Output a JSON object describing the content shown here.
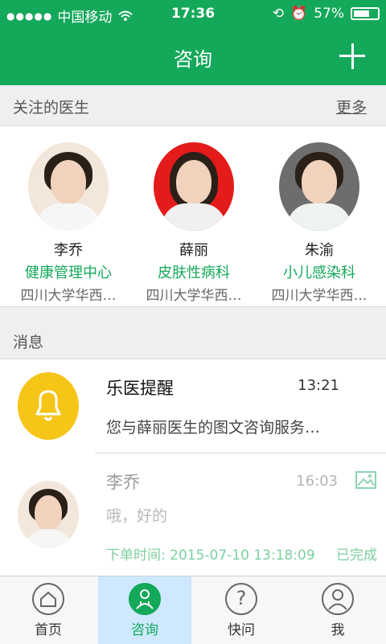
{
  "status_bar": {
    "carrier": "中国移动",
    "time": "17:36",
    "battery": "57%"
  },
  "nav": {
    "title": "咨询",
    "add_icon": "plus-icon"
  },
  "followed": {
    "title": "关注的医生",
    "more": "更多",
    "doctors": [
      {
        "name": "李乔",
        "dept": "健康管理中心",
        "hospital": "四川大学华西…",
        "avatar_bg": "#f3e6da"
      },
      {
        "name": "薛丽",
        "dept": "皮肤性病科",
        "hospital": "四川大学华西…",
        "avatar_bg": "#e41b1b"
      },
      {
        "name": "朱渝",
        "dept": "小儿感染科",
        "hospital": "四川大学华西…",
        "avatar_bg": "#6d6d6d"
      }
    ]
  },
  "messages": {
    "title": "消息",
    "items": [
      {
        "title": "乐医提醒",
        "time": "13:21",
        "text": "您与薛丽医生的图文咨询服务…",
        "icon": "bell-icon",
        "icon_bg": "#f5c518"
      },
      {
        "title": "李乔",
        "time": "16:03",
        "text": "哦，好的",
        "order_time": "下单时间: 2015-07-10 13:18:09",
        "status": "已完成",
        "icon": "image-icon"
      }
    ]
  },
  "tabs": [
    {
      "label": "首页",
      "icon": "home-icon"
    },
    {
      "label": "咨询",
      "icon": "doctor-icon"
    },
    {
      "label": "快问",
      "icon": "question-icon"
    },
    {
      "label": "我",
      "icon": "user-icon"
    }
  ],
  "colors": {
    "brand_green": "#14a85a",
    "tab_active_bg": "#cde8ff"
  }
}
